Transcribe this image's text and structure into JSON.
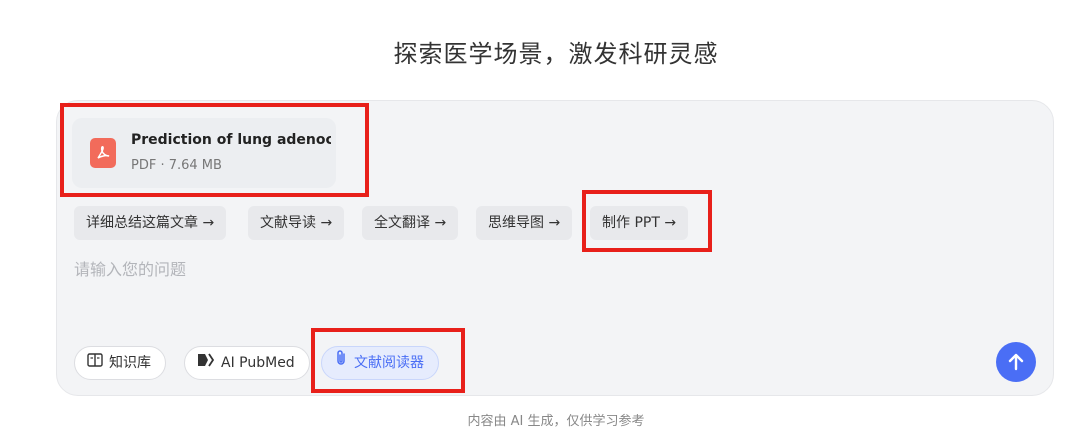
{
  "header": {
    "title": "探索医学场景，激发科研灵感"
  },
  "attachment": {
    "icon": "pdf-file-icon",
    "name": "Prediction of lung adenoc...",
    "meta": "PDF · 7.64 MB"
  },
  "quick_actions": [
    {
      "label": "详细总结这篇文章 →"
    },
    {
      "label": "文献导读 →"
    },
    {
      "label": "全文翻译 →"
    },
    {
      "label": "思维导图 →"
    },
    {
      "label": "制作 PPT →"
    }
  ],
  "input": {
    "placeholder": "请输入您的问题"
  },
  "tools": [
    {
      "label": "知识库",
      "icon": "book-icon"
    },
    {
      "label": "AI PubMed",
      "icon": "pubmed-icon"
    },
    {
      "label": "文献阅读器",
      "icon": "paperclip-icon",
      "active": true
    }
  ],
  "send": {
    "icon": "arrow-up-icon"
  },
  "footer": {
    "text": "内容由 AI 生成，仅供学习参考"
  },
  "colors": {
    "accent": "#4a6ef5",
    "highlight": "#e8201a",
    "pdf": "#f26b5b"
  }
}
